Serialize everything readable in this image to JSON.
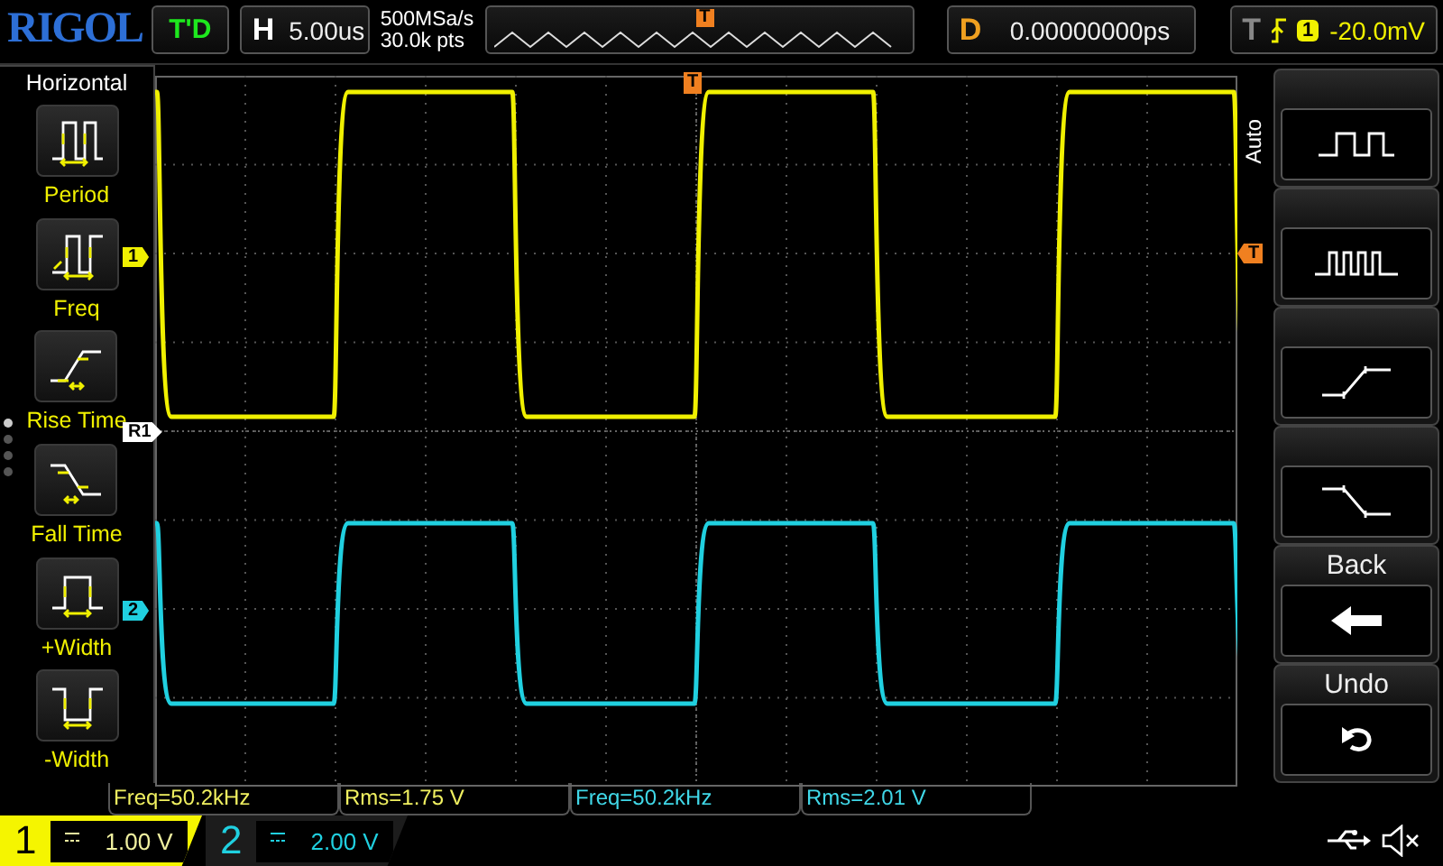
{
  "brand": "RIGOL",
  "run_status": "T'D",
  "horizontal": {
    "label": "H",
    "timebase": "5.00us"
  },
  "acquisition": {
    "sample_rate": "500MSa/s",
    "memory_depth": "30.0k pts"
  },
  "overview": {
    "trigger_mark": "T"
  },
  "delay": {
    "label": "D",
    "value": "0.00000000ps"
  },
  "trigger": {
    "label": "T",
    "source": "1",
    "level": "-20.0mV"
  },
  "left_menu": {
    "title": "Horizontal",
    "items": [
      {
        "label": "Period",
        "kind": "period"
      },
      {
        "label": "Freq",
        "kind": "freq"
      },
      {
        "label": "Rise Time",
        "kind": "rise"
      },
      {
        "label": "Fall Time",
        "kind": "fall"
      },
      {
        "label": "+Width",
        "kind": "pwidth"
      },
      {
        "label": "-Width",
        "kind": "nwidth"
      }
    ],
    "pages": [
      {
        "selected": true
      },
      {
        "selected": false
      },
      {
        "selected": false
      },
      {
        "selected": false
      }
    ]
  },
  "markers": {
    "ch1": "1",
    "reference": "R1",
    "ch2": "2",
    "trigger_position": "T",
    "trigger_level": "T"
  },
  "right_menu": {
    "side_label": "Auto",
    "keys": [
      {
        "kind": "square"
      },
      {
        "kind": "fast_square"
      },
      {
        "kind": "rise"
      },
      {
        "kind": "fall"
      },
      {
        "kind": "back",
        "label": "Back"
      },
      {
        "kind": "undo",
        "label": "Undo"
      }
    ]
  },
  "measurements": [
    {
      "text": "Freq=50.2kHz",
      "color": "#f0f060"
    },
    {
      "text": "Rms=1.75 V",
      "color": "#f0f060"
    },
    {
      "text": "Freq=50.2kHz",
      "color": "#40d8e8"
    },
    {
      "text": "Rms=2.01 V",
      "color": "#40d8e8"
    }
  ],
  "channels": [
    {
      "number": "1",
      "scale": "1.00 V",
      "selected": true,
      "color": "#f5f500"
    },
    {
      "number": "2",
      "scale": "2.00 V",
      "selected": false,
      "color": "#20d0e0"
    }
  ]
}
